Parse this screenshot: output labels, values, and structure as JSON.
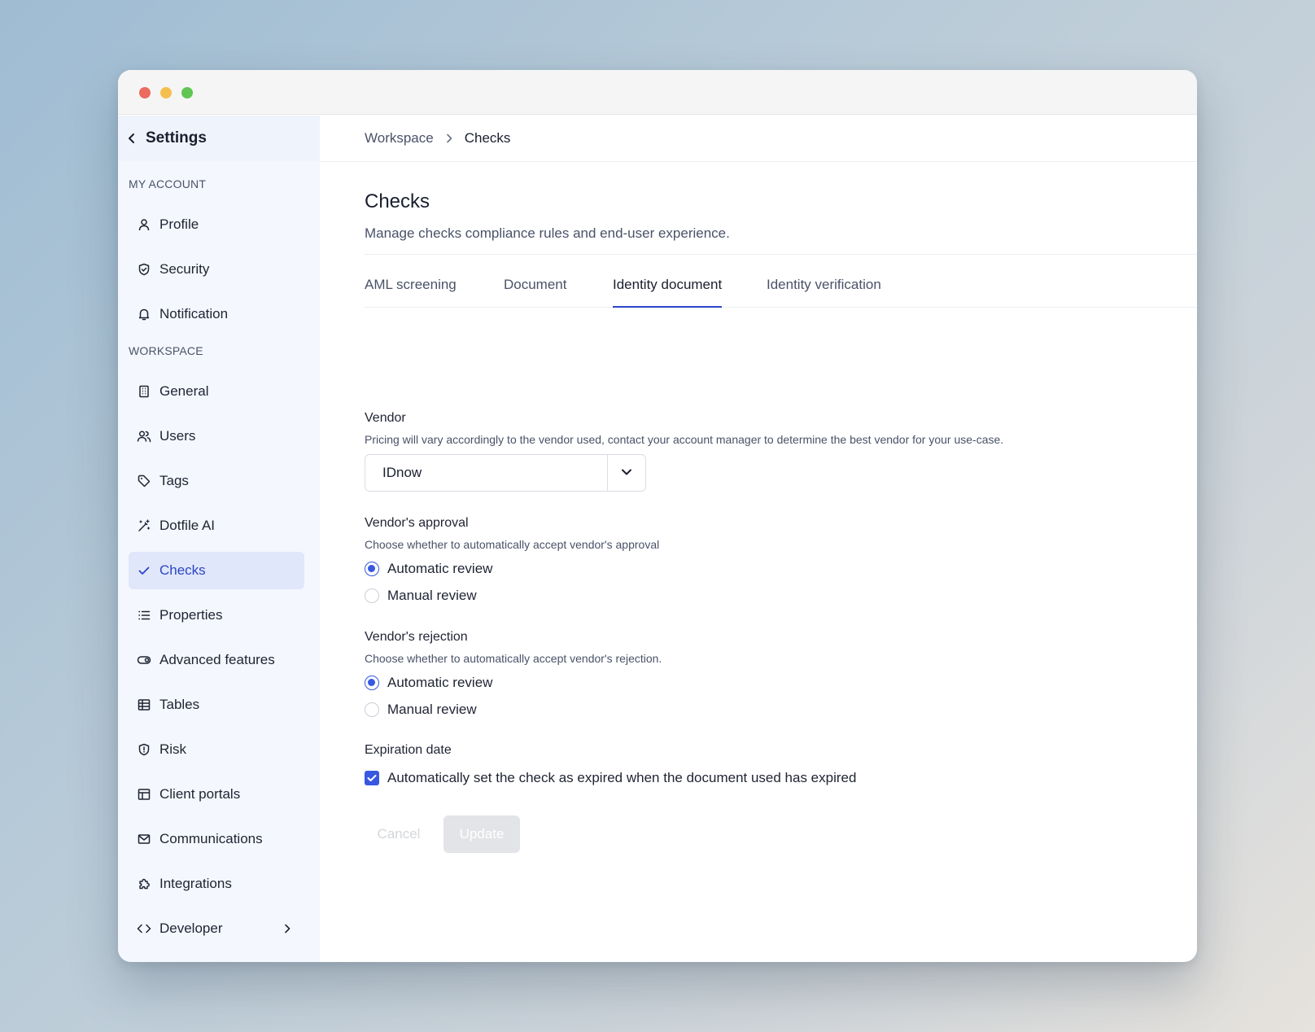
{
  "sidebar": {
    "title": "Settings",
    "sections": {
      "my_account": "MY ACCOUNT",
      "workspace": "WORKSPACE"
    },
    "items": {
      "profile": "Profile",
      "security": "Security",
      "notification": "Notification",
      "general": "General",
      "users": "Users",
      "tags": "Tags",
      "dotfile_ai": "Dotfile AI",
      "checks": "Checks",
      "properties": "Properties",
      "advanced_features": "Advanced features",
      "tables": "Tables",
      "risk": "Risk",
      "client_portals": "Client portals",
      "communications": "Communications",
      "integrations": "Integrations",
      "developer": "Developer"
    }
  },
  "breadcrumb": {
    "parent": "Workspace",
    "current": "Checks"
  },
  "page": {
    "title": "Checks",
    "subtitle": "Manage checks compliance rules and end-user experience."
  },
  "tabs": [
    "AML screening",
    "Document",
    "Identity document",
    "Identity verification"
  ],
  "active_tab": "Identity document",
  "form": {
    "vendor": {
      "label": "Vendor",
      "help": "Pricing will vary accordingly to the vendor used, contact your account manager to determine the best vendor for your use-case.",
      "value": "IDnow"
    },
    "approval": {
      "label": "Vendor's approval",
      "help": "Choose whether to automatically accept vendor's approval",
      "options": [
        "Automatic review",
        "Manual review"
      ],
      "selected": "Automatic review"
    },
    "rejection": {
      "label": "Vendor's rejection",
      "help": "Choose whether to automatically accept vendor's rejection.",
      "options": [
        "Automatic review",
        "Manual review"
      ],
      "selected": "Automatic review"
    },
    "expiration": {
      "label": "Expiration date",
      "checkbox_label": "Automatically set the check as expired when the document used has expired",
      "checked": true
    }
  },
  "buttons": {
    "cancel": "Cancel",
    "update": "Update"
  },
  "colors": {
    "accent": "#3858e0",
    "active_nav_bg": "#e0e7fb"
  }
}
